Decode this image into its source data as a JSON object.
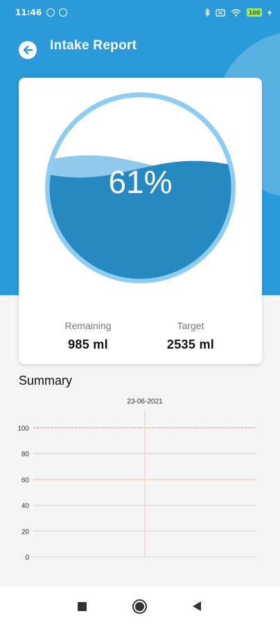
{
  "status_bar": {
    "time": "11:46",
    "battery": "100"
  },
  "header": {
    "title": "Intake Report"
  },
  "gauge": {
    "percent_label": "61%",
    "fill_fraction": 0.61
  },
  "stats": {
    "remaining_label": "Remaining",
    "remaining_value": "985 ml",
    "target_label": "Target",
    "target_value": "2535 ml"
  },
  "summary": {
    "title": "Summary"
  },
  "colors": {
    "primary": "#2a9ad8",
    "water_dark": "#2689c0",
    "water_light": "#8fc9ec",
    "ring": "#8fcdf0",
    "target_line": "#e2a3a3",
    "goal_line": "#f1d2b9"
  },
  "chart_data": {
    "type": "bar",
    "categories": [
      "23-06-2021"
    ],
    "values": [
      0
    ],
    "title": "",
    "xlabel": "",
    "ylabel": "",
    "ylim": [
      0,
      100
    ],
    "yticks": [
      0,
      20,
      40,
      60,
      80,
      100
    ],
    "limit_lines": [
      100,
      60
    ],
    "grid": true
  }
}
